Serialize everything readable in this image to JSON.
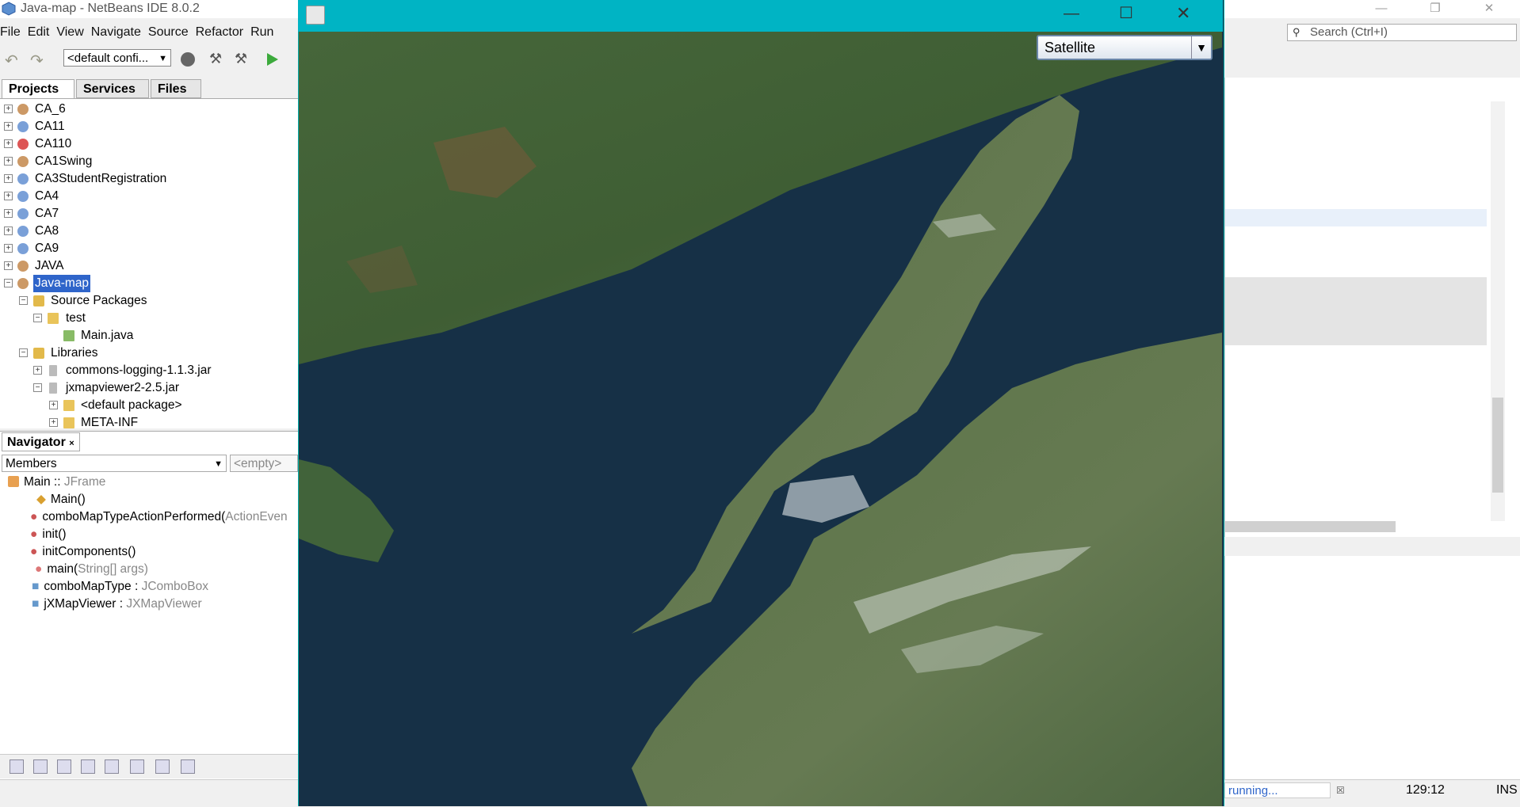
{
  "ide": {
    "title": "Java-map - NetBeans IDE 8.0.2",
    "menu": [
      "File",
      "Edit",
      "View",
      "Navigate",
      "Source",
      "Refactor",
      "Run"
    ],
    "config_combo": "<default confi...",
    "search_placeholder": "Search (Ctrl+I)"
  },
  "tabs": [
    "Projects",
    "Services",
    "Files"
  ],
  "project_tree": [
    {
      "label": "CA_6"
    },
    {
      "label": "CA11"
    },
    {
      "label": "CA110"
    },
    {
      "label": "CA1Swing"
    },
    {
      "label": "CA3StudentRegistration"
    },
    {
      "label": "CA4"
    },
    {
      "label": "CA7"
    },
    {
      "label": "CA8"
    },
    {
      "label": "CA9"
    },
    {
      "label": "JAVA"
    },
    {
      "label": "Java-map"
    },
    {
      "label": "Source Packages"
    },
    {
      "label": "test"
    },
    {
      "label": "Main.java"
    },
    {
      "label": "Libraries"
    },
    {
      "label": "commons-logging-1.1.3.jar"
    },
    {
      "label": "jxmapviewer2-2.5.jar"
    },
    {
      "label": "<default package>"
    },
    {
      "label": "META-INF"
    }
  ],
  "navigator": {
    "tab": "Navigator",
    "members_combo": "Members",
    "empty_combo": "<empty>",
    "root_name": "Main",
    "root_sep": " :: ",
    "root_type": "JFrame",
    "items": [
      {
        "name": "Main()",
        "type": ""
      },
      {
        "name": "comboMapTypeActionPerformed(",
        "type": "ActionEven"
      },
      {
        "name": "init()",
        "type": ""
      },
      {
        "name": "initComponents()",
        "type": ""
      },
      {
        "name": "main(",
        "type": "String[] args)"
      },
      {
        "name": "comboMapType : ",
        "type": "JComboBox"
      },
      {
        "name": "jXMapViewer : ",
        "type": "JXMapViewer"
      }
    ]
  },
  "status": {
    "running": "running...",
    "position": "129:12",
    "mode": "INS"
  },
  "map_window": {
    "map_type": "Satellite"
  },
  "colors": {
    "accent": "#00b4c4",
    "selection": "#2f65ca",
    "water": "#163046",
    "land": "#4e6e3a"
  }
}
